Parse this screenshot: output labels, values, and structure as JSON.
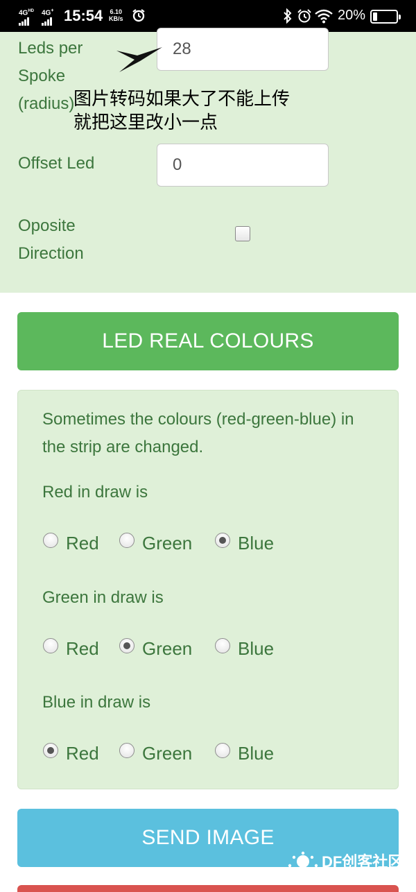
{
  "status_bar": {
    "network_1": "4G",
    "network_1_sup": "HD",
    "network_2": "4G",
    "network_2_sup": "+",
    "time": "15:54",
    "speed_value": "6.10",
    "speed_unit": "KB/s",
    "battery_percent": "20%",
    "battery_level": 0.2
  },
  "settings": {
    "leds_per_spoke_label": "Leds per Spoke (radius)",
    "leds_per_spoke_value": "28",
    "offset_led_label": "Offset Led",
    "offset_led_value": "0",
    "opposite_direction_label": "Oposite Direction",
    "opposite_direction_checked": false
  },
  "annotation": {
    "line_1": "图片转码如果大了不能上传",
    "line_2": "就把这里改小一点"
  },
  "led_real_colours_button": "LED REAL COLOURS",
  "colours_panel": {
    "intro": "Sometimes the colours (red-green-blue) in the strip are changed.",
    "groups": [
      {
        "label": "Red in draw is",
        "options": [
          "Red",
          "Green",
          "Blue"
        ],
        "selected": "Blue"
      },
      {
        "label": "Green in draw is",
        "options": [
          "Red",
          "Green",
          "Blue"
        ],
        "selected": "Green"
      },
      {
        "label": "Blue in draw is",
        "options": [
          "Red",
          "Green",
          "Blue"
        ],
        "selected": "Red"
      }
    ]
  },
  "send_image_button": "SEND IMAGE",
  "watermark": "DF创客社区",
  "colors": {
    "panel_bg": "#dff0d8",
    "panel_text": "#3c763d",
    "success": "#5cb85c",
    "info": "#5bc0de",
    "danger": "#d9534f"
  }
}
